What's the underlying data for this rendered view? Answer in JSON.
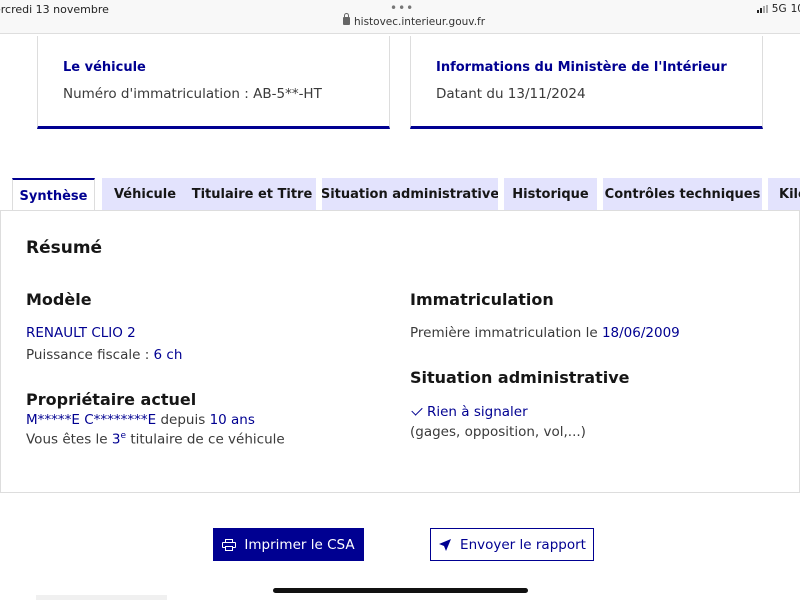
{
  "status_bar": {
    "time": "ercredi 13 novembre",
    "url": "histovec.interieur.gouv.fr",
    "network": "5G",
    "battery": "10"
  },
  "cards": {
    "vehicle": {
      "title": "Le véhicule",
      "text": "Numéro d'immatriculation : AB-5**-HT"
    },
    "ministry": {
      "title": "Informations du Ministère de l'Intérieur",
      "text": "Datant du 13/11/2024"
    }
  },
  "tabs": [
    {
      "label": "Synthèse",
      "active": true
    },
    {
      "label": "Véhicule"
    },
    {
      "label": "Titulaire et Titre"
    },
    {
      "label": "Situation administrative"
    },
    {
      "label": "Historique"
    },
    {
      "label": "Contrôles techniques"
    },
    {
      "label": "Kilo"
    }
  ],
  "summary": {
    "heading": "Résumé",
    "model": {
      "heading": "Modèle",
      "name": "RENAULT CLIO 2",
      "power_label": "Puissance fiscale : ",
      "power_value": "6 ch"
    },
    "owner": {
      "heading": "Propriétaire actuel",
      "name": "M*****E C********E",
      "since_label": " depuis ",
      "since_value": "10 ans",
      "rank_prefix": "Vous êtes le ",
      "rank_num": "3",
      "rank_sup": "e",
      "rank_suffix": " titulaire de ce véhicule"
    },
    "registration": {
      "heading": "Immatriculation",
      "first_label": "Première immatriculation le ",
      "first_date": "18/06/2009"
    },
    "admin": {
      "heading": "Situation administrative",
      "status": "Rien à signaler",
      "details": "(gages, opposition, vol,...)"
    }
  },
  "buttons": {
    "print": "Imprimer le CSA",
    "send": "Envoyer le rapport"
  },
  "colors": {
    "primary": "#000091",
    "tab_bg": "#e3e3fd"
  }
}
